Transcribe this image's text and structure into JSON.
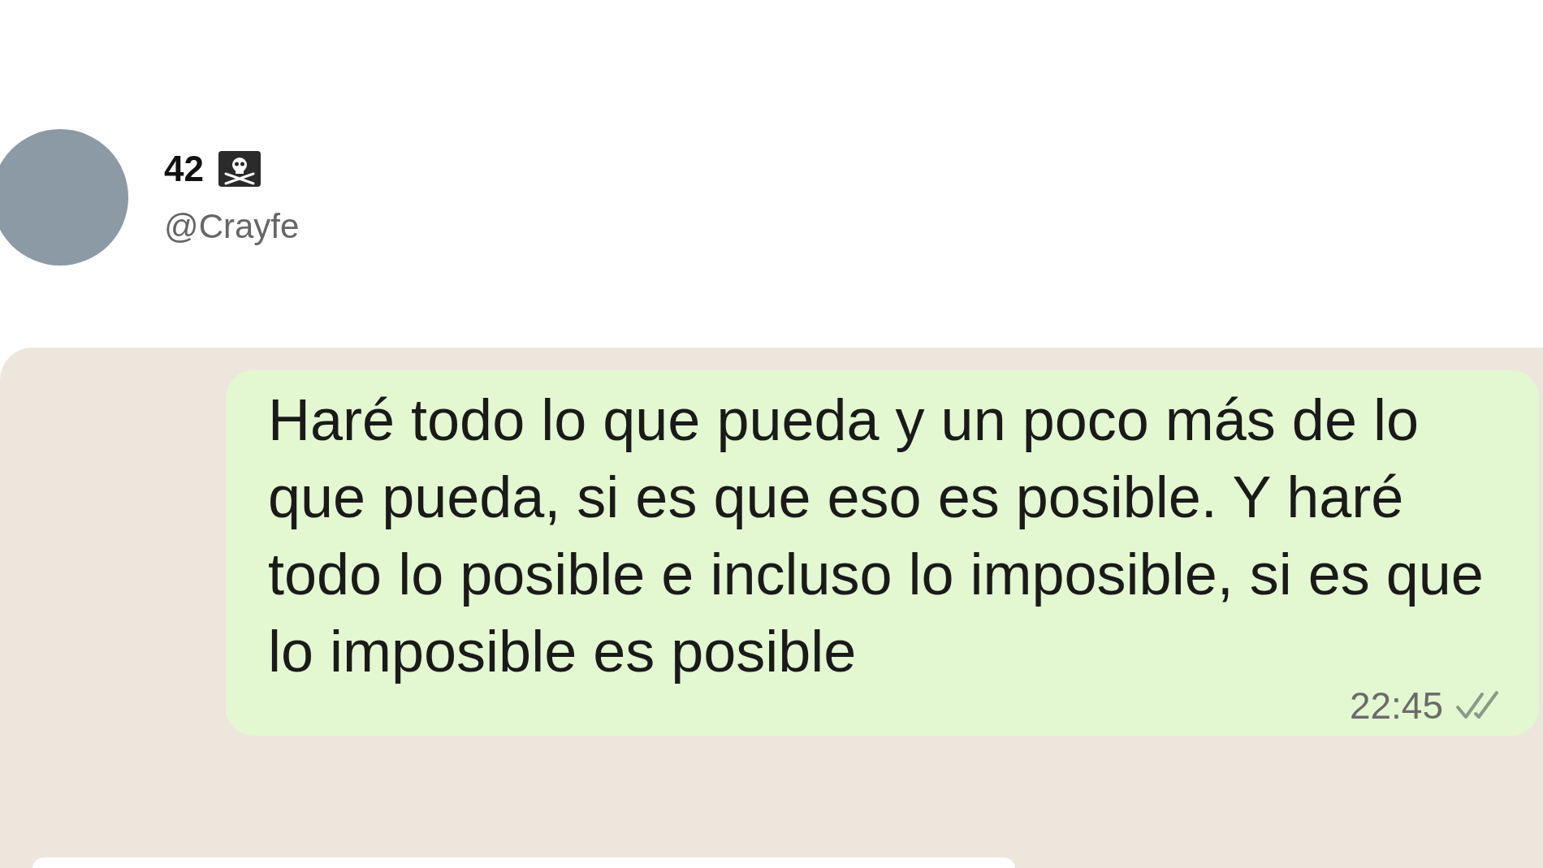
{
  "author": {
    "name": "42",
    "handle": "@Crayfe"
  },
  "chat": {
    "message": {
      "text": "Haré todo lo que pueda y un poco más de lo que pueda, si es que eso es posible. Y haré todo lo posible e incluso lo imposible, si es que lo imposible es posible",
      "time": "22:45"
    }
  }
}
